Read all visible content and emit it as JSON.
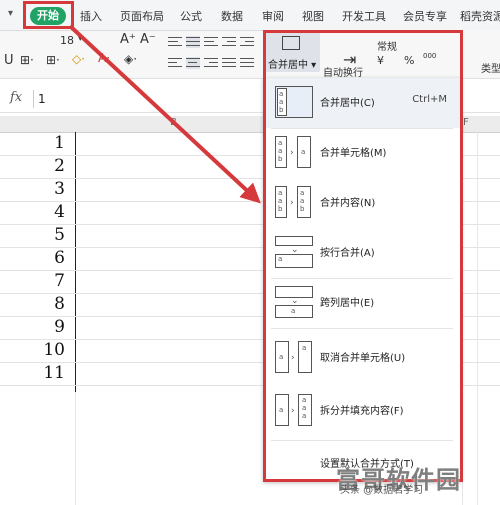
{
  "tabs": {
    "start": "开始",
    "items": [
      "插入",
      "页面布局",
      "公式",
      "数据",
      "审阅",
      "视图",
      "开发工具",
      "会员专享",
      "稻壳资源"
    ]
  },
  "ribbon": {
    "font_size": "18",
    "format_label": "常规",
    "merge_button_label": "合并居中",
    "wrap_label": "自动换行",
    "currency_symbol": "¥",
    "percent_symbol": "%",
    "thousands_label": "000",
    "type_label": "类型"
  },
  "formula_bar": {
    "fx_label": "fx",
    "cell_value": "1"
  },
  "columns": {
    "b": "B",
    "f": "F"
  },
  "rows": [
    "1",
    "2",
    "3",
    "4",
    "5",
    "6",
    "7",
    "8",
    "9",
    "10",
    "11"
  ],
  "merge_menu": {
    "items": [
      {
        "label": "合并居中(C)",
        "shortcut": "Ctrl+M"
      },
      {
        "label": "合并单元格(M)",
        "shortcut": ""
      },
      {
        "label": "合并内容(N)",
        "shortcut": ""
      },
      {
        "label": "按行合并(A)",
        "shortcut": ""
      },
      {
        "label": "跨列居中(E)",
        "shortcut": ""
      },
      {
        "label": "取消合并单元格(U)",
        "shortcut": ""
      },
      {
        "label": "拆分并填充内容(F)",
        "shortcut": ""
      }
    ],
    "footer": "设置默认合并方式(T)"
  },
  "watermark": {
    "brand": "富哥软件园",
    "sub": "头条 @数据君学习"
  },
  "colors": {
    "accent_green": "#21a366",
    "annotation_red": "#d5393b"
  }
}
